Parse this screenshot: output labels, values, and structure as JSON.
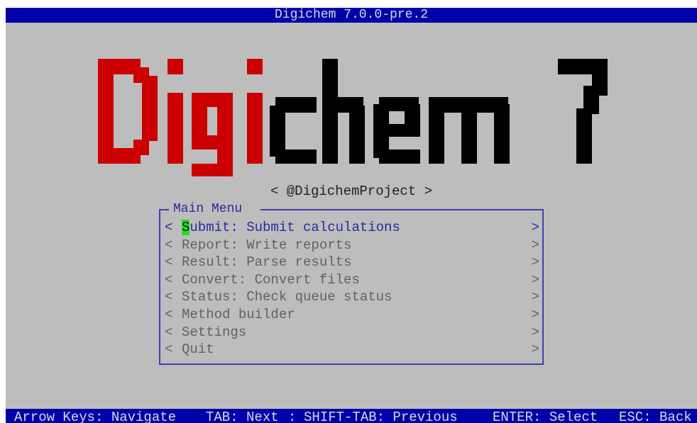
{
  "title_bar": {
    "text": "Digichem 7.0.0-pre.2",
    "background": "#0000a8"
  },
  "logo": {
    "text_red": "Digi",
    "text_black": "chem",
    "version_number": "7",
    "red_color": "#cc0000",
    "black_color": "#000000"
  },
  "handle": {
    "text": "< @DigichemProject >"
  },
  "main_menu": {
    "title": "Main Menu",
    "border_color": "#3f3fb0",
    "items": [
      {
        "first_char": "S",
        "rest": "ubmit: Submit calculations",
        "selected": true
      },
      {
        "first_char": "R",
        "rest": "eport: Write reports",
        "selected": false
      },
      {
        "first_char": "R",
        "rest": "esult: Parse results",
        "selected": false
      },
      {
        "first_char": "C",
        "rest": "onvert: Convert files",
        "selected": false
      },
      {
        "first_char": "S",
        "rest": "tatus: Check queue status",
        "selected": false
      },
      {
        "first_char": "M",
        "rest": "ethod builder",
        "selected": false
      },
      {
        "first_char": "S",
        "rest": "ettings",
        "selected": false
      },
      {
        "first_char": "Q",
        "rest": "uit",
        "selected": false
      }
    ],
    "open_bracket": "<",
    "close_bracket": ">",
    "cursor_color": "#22dd22"
  },
  "status_bar": {
    "items": [
      "Arrow Keys: Navigate",
      "TAB: Next",
      "SHIFT-TAB: Previous",
      "ENTER: Select",
      "ESC: Back"
    ],
    "separators": [
      " ",
      ": ",
      " ",
      " "
    ]
  }
}
